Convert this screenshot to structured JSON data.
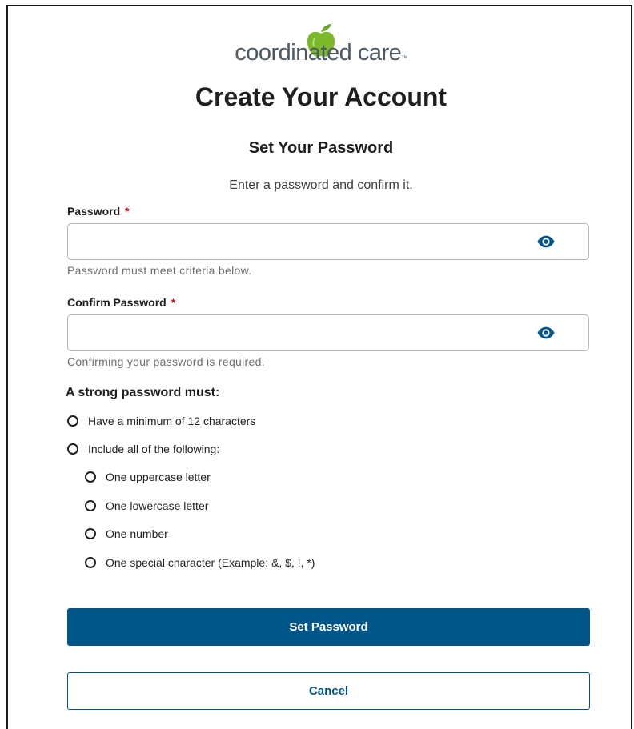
{
  "logo": {
    "icon": "apple-icon",
    "text": "coordinated care",
    "trademark": "™"
  },
  "header": {
    "title": "Create Your Account"
  },
  "form": {
    "section_title": "Set Your Password",
    "instruction": "Enter a password and confirm it.",
    "password": {
      "label": "Password",
      "required_mark": "*",
      "value": "",
      "helper": "Password must meet criteria below.",
      "toggle_icon": "eye-icon"
    },
    "confirm_password": {
      "label": "Confirm Password",
      "required_mark": "*",
      "value": "",
      "helper": "Confirming your password is required.",
      "toggle_icon": "eye-icon"
    }
  },
  "requirements": {
    "title": "A strong password must:",
    "items": [
      "Have a minimum of 12 characters",
      "Include all of the following:"
    ],
    "sub_items": [
      "One uppercase letter",
      "One lowercase letter",
      "One number",
      "One special character (Example: &, $, !, *)"
    ]
  },
  "actions": {
    "submit_label": "Set Password",
    "cancel_label": "Cancel"
  },
  "colors": {
    "primary": "#005689",
    "required": "#d0021b",
    "logo_green": "#7ab929",
    "logo_text": "#4f5963"
  }
}
